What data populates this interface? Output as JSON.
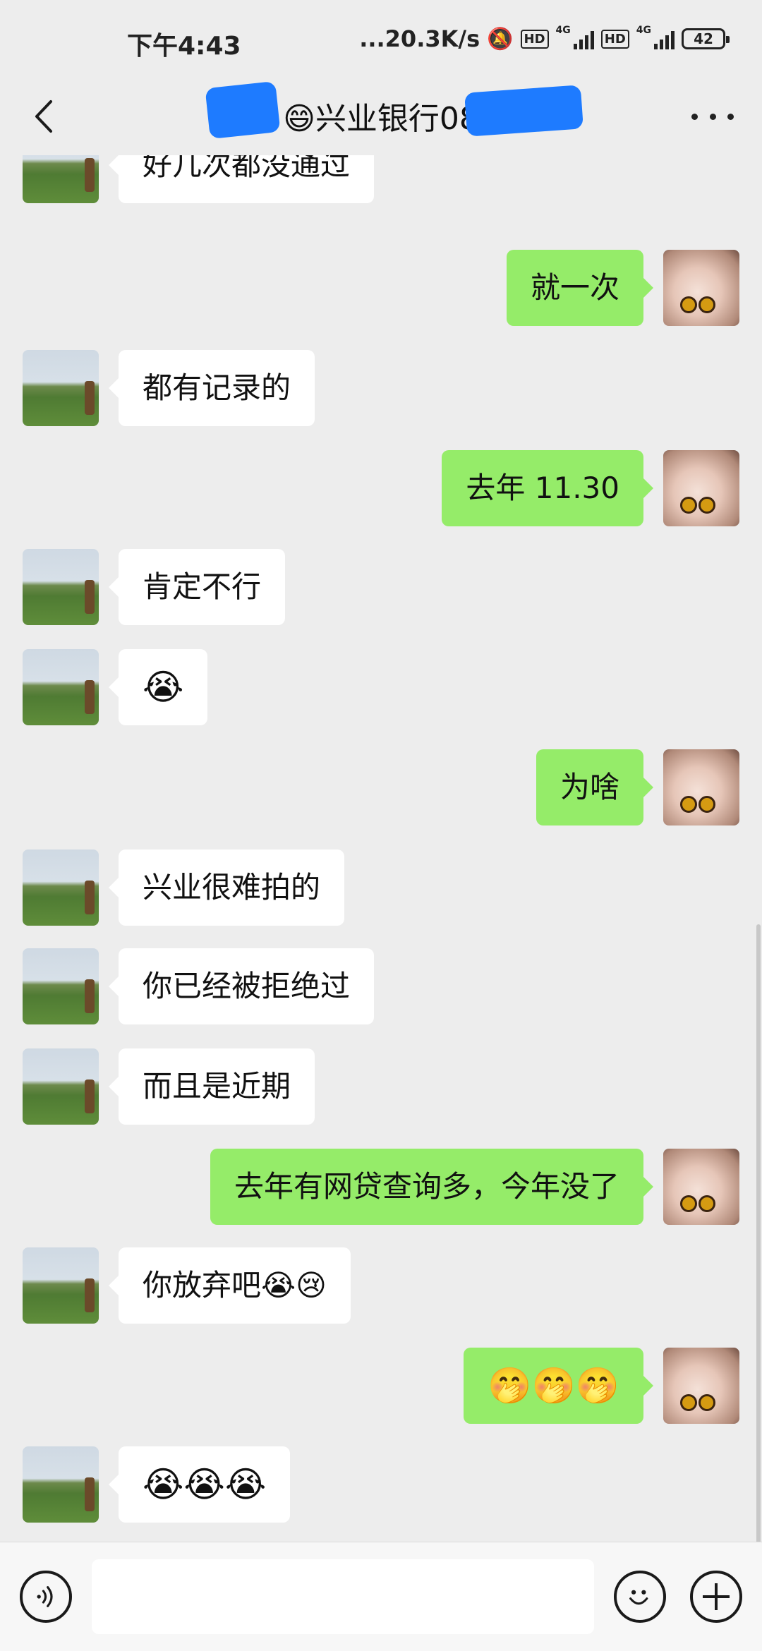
{
  "status_bar": {
    "time": "下午4:43",
    "net_speed": "...20.3K/s",
    "hd1": "HD",
    "net1": "4G",
    "hd2": "HD",
    "net2": "4G",
    "battery": "42"
  },
  "header": {
    "title": "兴业银行08",
    "title_emoji": "😄"
  },
  "messages": [
    {
      "side": "left",
      "text": "好几次都没通过"
    },
    {
      "side": "right",
      "text": "就一次"
    },
    {
      "side": "left",
      "text": "都有记录的"
    },
    {
      "side": "right",
      "text": "去年 11.30"
    },
    {
      "side": "left",
      "text": "肯定不行"
    },
    {
      "side": "left",
      "text": "😭"
    },
    {
      "side": "right",
      "text": "为啥"
    },
    {
      "side": "left",
      "text": "兴业很难拍的"
    },
    {
      "side": "left",
      "text": "你已经被拒绝过"
    },
    {
      "side": "left",
      "text": "而且是近期"
    },
    {
      "side": "right",
      "text": "去年有网贷查询多，今年没了"
    },
    {
      "side": "left",
      "text": "你放弃吧😭😢"
    },
    {
      "side": "right",
      "text": "🤭🤭🤭"
    },
    {
      "side": "left",
      "text": "😭😭😭"
    }
  ],
  "input": {
    "placeholder": ""
  },
  "colors": {
    "background": "#ededed",
    "bubble_self": "#95ec69",
    "bubble_other": "#ffffff"
  },
  "icons": {
    "back": "back-arrow-icon",
    "more": "more-dots-icon",
    "voice": "voice-icon",
    "emoji": "emoji-icon",
    "plus": "plus-icon"
  }
}
